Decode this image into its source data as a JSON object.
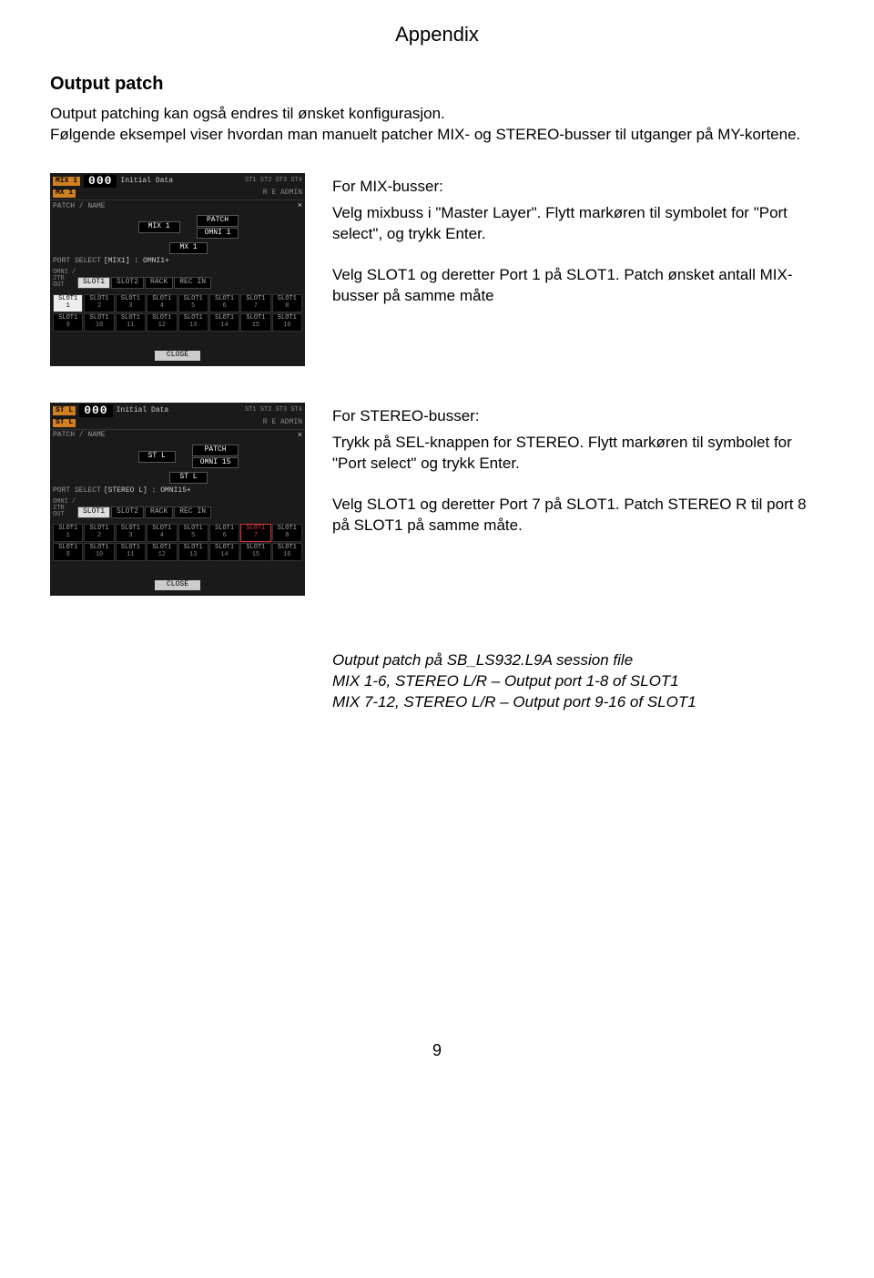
{
  "header": {
    "title": "Appendix"
  },
  "section": {
    "heading": "Output patch",
    "intro": "Output patching kan også endres til ønsket konfigurasjon.\nFølgende eksempel viser hvordan man manuelt patcher MIX- og STEREO-busser til utganger på MY-kortene."
  },
  "mix": {
    "topName1": "MIX 1",
    "topName2": "MX 1",
    "num": "000",
    "init": "Initial Data",
    "status": "ST1 ST2 ST3 ST4",
    "admin": "R E   ADMIN",
    "patchName": "PATCH / NAME",
    "closeX": "×",
    "mixLabel": "MIX 1",
    "editLabel": "MX 1",
    "patchLabel": "PATCH",
    "patchVal": "OMNI 1",
    "portSelect": "PORT SELECT",
    "portText": "[MIX1] : OMNI1+",
    "stub1": "OMNI /",
    "stub2": "2TR OUT",
    "tabs": [
      "SLOT1",
      "SLOT2",
      "RACK",
      "REC IN"
    ],
    "grid": [
      [
        1,
        2,
        3,
        4,
        5,
        6,
        7,
        8
      ],
      [
        9,
        10,
        11,
        12,
        13,
        14,
        15,
        16
      ]
    ],
    "selectedPort": 1,
    "close": "CLOSE",
    "desc_head": "For MIX-busser:",
    "desc_p1": "Velg mixbuss i \"Master Layer\". Flytt markøren til symbolet for \"Port select\", og trykk Enter.",
    "desc_p2": "Velg SLOT1 og deretter Port 1 på SLOT1. Patch ønsket antall MIX-busser på samme måte"
  },
  "stereo": {
    "topName1": "ST L",
    "topName2": "ST L",
    "num": "000",
    "init": "Initial Data",
    "status": "ST1 ST2 ST3 ST4",
    "admin": "R E   ADMIN",
    "patchName": "PATCH / NAME",
    "closeX": "×",
    "mixLabel": "ST L",
    "editLabel": "ST L",
    "patchLabel": "PATCH",
    "patchVal": "OMNI 15",
    "portSelect": "PORT SELECT",
    "portText": "[STEREO L] : OMNI15+",
    "stub1": "OMNI /",
    "stub2": "2TR OUT",
    "tabs": [
      "SLOT1",
      "SLOT2",
      "RACK",
      "REC IN"
    ],
    "grid": [
      [
        1,
        2,
        3,
        4,
        5,
        6,
        7,
        8
      ],
      [
        9,
        10,
        11,
        12,
        13,
        14,
        15,
        16
      ]
    ],
    "selectedPort": 7,
    "close": "CLOSE",
    "desc_head": "For STEREO-busser:",
    "desc_p1": "Trykk på SEL-knappen for STEREO. Flytt markøren til symbolet for \"Port select\" og trykk Enter.",
    "desc_p2": "Velg SLOT1 og deretter Port 7 på SLOT1. Patch STEREO R til port 8 på SLOT1 på samme måte."
  },
  "session": {
    "line1": "Output patch på SB_LS932.L9A session file",
    "line2": "MIX 1-6, STEREO L/R – Output port 1-8 of SLOT1",
    "line3": "MIX 7-12, STEREO L/R – Output port 9-16 of SLOT1"
  },
  "pageNumber": "9"
}
